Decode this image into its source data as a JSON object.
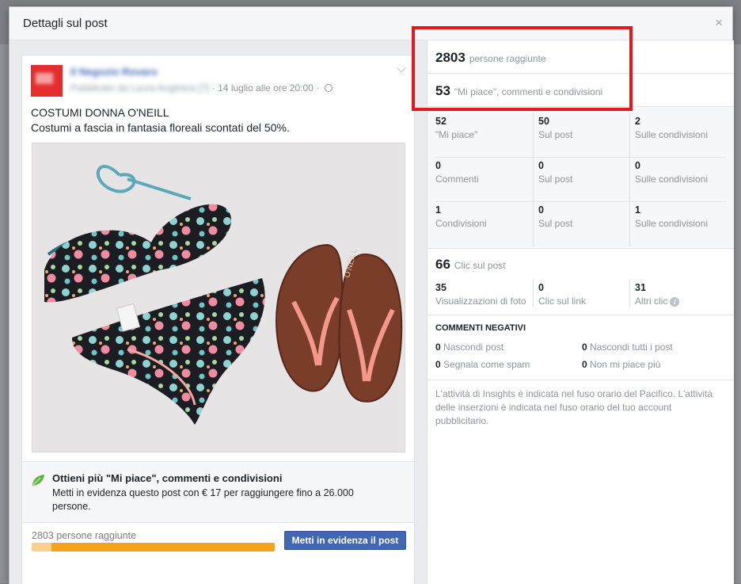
{
  "dialog": {
    "title": "Dettagli sul post",
    "close_icon": "×"
  },
  "post": {
    "page_name": "Il Negozio Rovaro",
    "published_by": "Pubblicato da Laura Anglmesi [?]",
    "date": "14 luglio alle ore 20:00",
    "separator": "·",
    "title": "COSTUMI DONNA O'NEILL",
    "text": "Costumi a fascia in fantasia floreali scontati del 50%.",
    "image_brand": "O'NEILL"
  },
  "boost": {
    "title": "Ottieni più \"Mi piace\", commenti e condivisioni",
    "description": "Metti in evidenza questo post con € 17 per raggiungere fino a 26.000 persone.",
    "reach_label": "2803 persone raggiunte",
    "reach_progress_fraction": 0.08,
    "button_label": "Metti in evidenza il post",
    "accent_color": "#f7a21b",
    "button_color": "#4267b2"
  },
  "insights": {
    "reach": {
      "value": "2803",
      "label": "persone raggiunte"
    },
    "engagement": {
      "value": "53",
      "label": "\"Mi piace\", commenti e condivisioni"
    },
    "breakdown": [
      {
        "total": {
          "value": "52",
          "label": "\"Mi piace\""
        },
        "on_post": {
          "value": "50",
          "label": "Sul post"
        },
        "on_shares": {
          "value": "2",
          "label": "Sulle condivisioni"
        }
      },
      {
        "total": {
          "value": "0",
          "label": "Commenti"
        },
        "on_post": {
          "value": "0",
          "label": "Sul post"
        },
        "on_shares": {
          "value": "0",
          "label": "Sulle condivisioni"
        }
      },
      {
        "total": {
          "value": "1",
          "label": "Condivisioni"
        },
        "on_post": {
          "value": "0",
          "label": "Sul post"
        },
        "on_shares": {
          "value": "1",
          "label": "Sulle condivisioni"
        }
      }
    ],
    "clicks": {
      "value": "66",
      "label": "Clic sul post",
      "items": [
        {
          "value": "35",
          "label": "Visualizzazioni di foto"
        },
        {
          "value": "0",
          "label": "Clic sul link"
        },
        {
          "value": "31",
          "label": "Altri clic"
        }
      ]
    },
    "negative": {
      "title": "COMMENTI NEGATIVI",
      "items": [
        {
          "value": "0",
          "label": "Nascondi post"
        },
        {
          "value": "0",
          "label": "Nascondi tutti i post"
        },
        {
          "value": "0",
          "label": "Segnala come spam"
        },
        {
          "value": "0",
          "label": "Non mi piace più"
        }
      ]
    },
    "footnote": "L'attività di Insights è indicata nel fuso orario del Pacifico. L'attività delle inserzioni è indicata nel fuso orario del tuo account pubblicitario.",
    "highlight_color": "#e5191c"
  }
}
